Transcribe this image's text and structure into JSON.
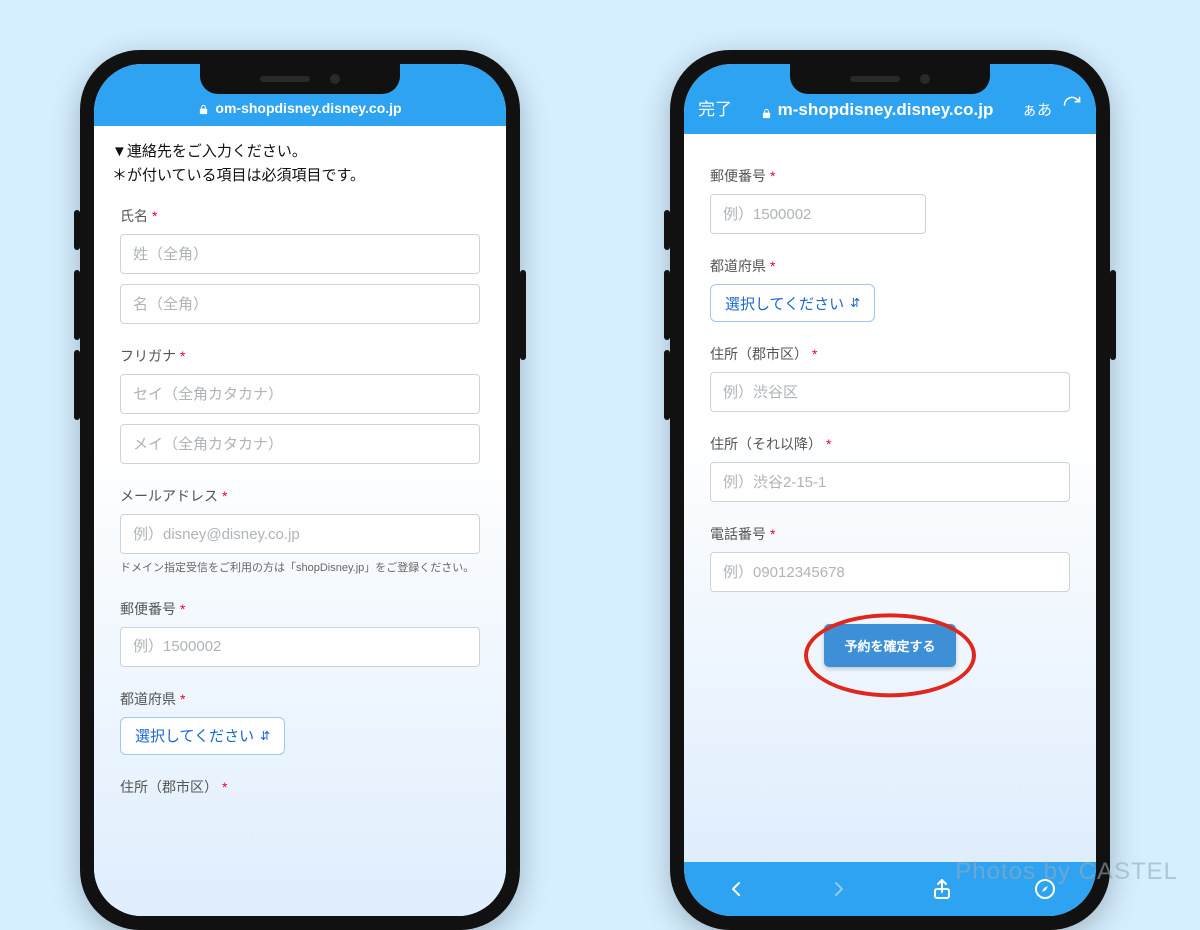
{
  "watermark": "Photos by CASTEL",
  "left": {
    "url": "om-shopdisney.disney.co.jp",
    "intro_l1": "▼連絡先をご入力ください。",
    "intro_l2": "＊が付いている項目は必須項目です。",
    "name": {
      "label": "氏名",
      "last_ph": "姓（全角）",
      "first_ph": "名（全角）"
    },
    "kana": {
      "label": "フリガナ",
      "last_ph": "セイ（全角カタカナ）",
      "first_ph": "メイ（全角カタカナ）"
    },
    "email": {
      "label": "メールアドレス",
      "ph": "例）disney@disney.co.jp",
      "help": "ドメイン指定受信をご利用の方は「shopDisney.jp」をご登録ください。"
    },
    "postal": {
      "label": "郵便番号",
      "ph": "例）1500002"
    },
    "pref": {
      "label": "都道府県",
      "select": "選択してください"
    },
    "city": {
      "label": "住所（郡市区）"
    }
  },
  "right": {
    "done": "完了",
    "url": "m-shopdisney.disney.co.jp",
    "aa": "ぁあ",
    "postal": {
      "label": "郵便番号",
      "ph": "例）1500002"
    },
    "pref": {
      "label": "都道府県",
      "select": "選択してください"
    },
    "city": {
      "label": "住所（郡市区）",
      "ph": "例）渋谷区"
    },
    "rest": {
      "label": "住所（それ以降）",
      "ph": "例）渋谷2-15-1"
    },
    "tel": {
      "label": "電話番号",
      "ph": "例）09012345678"
    },
    "submit": "予約を確定する"
  },
  "req_mark": "*"
}
